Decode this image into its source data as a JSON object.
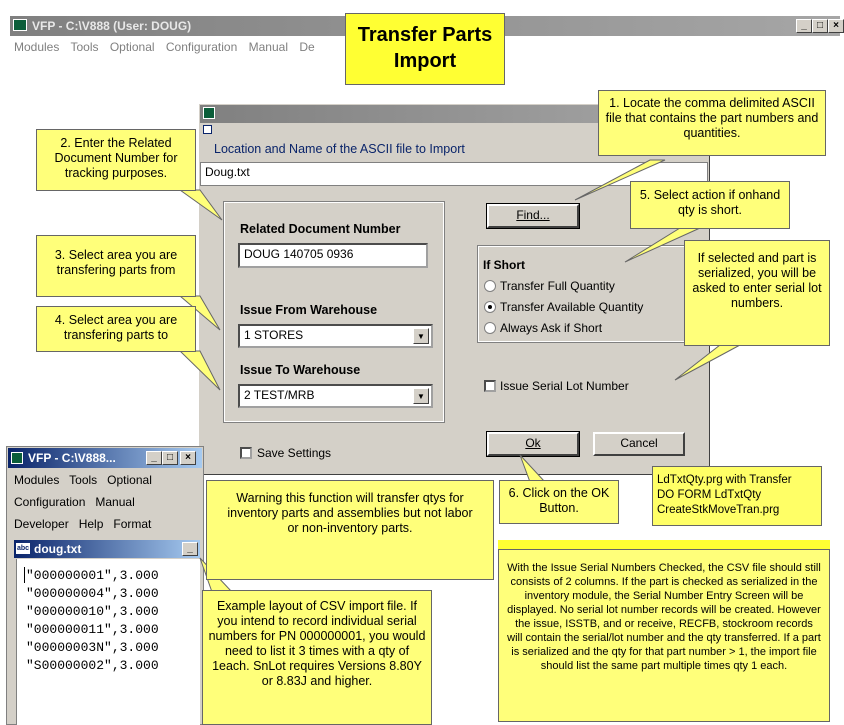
{
  "main_window": {
    "title": "VFP - C:\\V888 (User: DOUG)",
    "menu": [
      "Modules",
      "Tools",
      "Optional",
      "Configuration",
      "Manual",
      "De"
    ]
  },
  "banner": "Transfer Parts\nImport",
  "dialog": {
    "location_label": "Location and Name of the ASCII file to Import",
    "file_value": "Doug.txt",
    "related_doc_label": "Related Document Number",
    "related_doc_value": "DOUG 140705 0936",
    "from_label": "Issue From Warehouse",
    "from_value": "1  STORES",
    "to_label": "Issue To Warehouse",
    "to_value": "2  TEST/MRB",
    "find_button": "Find...",
    "if_short_label": "If Short",
    "options": [
      {
        "label": "Transfer Full Quantity",
        "selected": false
      },
      {
        "label": "Transfer Available Quantity",
        "selected": true
      },
      {
        "label": "Always Ask if Short",
        "selected": false
      }
    ],
    "serial_checkbox": "Issue Serial Lot Number",
    "save_settings": "Save Settings",
    "ok_button": "Ok",
    "cancel_button": "Cancel"
  },
  "mini_window": {
    "title": "VFP - C:\\V888...",
    "menu_lines": [
      "Modules   Tools   Optional",
      "Configuration   Manual",
      "Developer   Help   Format"
    ],
    "doc_title": "doug.txt",
    "lines": [
      "\"000000001\",3.000",
      "\"000000004\",3.000",
      "\"000000010\",3.000",
      "\"000000011\",3.000",
      "\"00000003N\",3.000",
      "\"S00000002\",3.000"
    ]
  },
  "callouts": {
    "c1": "1. Locate the comma delimited ASCII file that contains the part numbers and quantities.",
    "c2": "2. Enter the Related Document Number for tracking purposes.",
    "c3": "3. Select area you are transfering  parts from",
    "c4": "4. Select area you are transfering parts to",
    "c5": "5. Select action if onhand qty is short.",
    "c6": "6. Click on the OK Button.",
    "serialized": "If selected and part is serialized, you will be asked to enter serial lot numbers.",
    "warning": "Warning this function will transfer qtys for inventory parts and assemblies but not labor or non-inventory parts.",
    "example": "Example layout of CSV import file. If you intend to record individual serial numbers for PN 000000001, you would need to list it 3 times with a qty of 1each. SnLot requires Versions 8.80Y or 8.83J and higher.",
    "program": "LdTxtQty.prg with Transfer\nDO FORM LdTxtQty\nCreateStkMoveTran.prg",
    "serial_notes": "With the Issue Serial Numbers Checked, the CSV file should still consists of 2 columns.  If the part is checked as serialized in the inventory module, the Serial Number Entry Screen will be displayed.  No serial lot number records will be created.  However the issue, ISSTB, and or receive, RECFB, stockroom records will contain the serial/lot number and the qty transferred.  If a part is serialized and the qty for that part number > 1, the import file should list the same part multiple times qty 1 each."
  },
  "colors": {
    "callout": "#ffff7a",
    "dialog": "#d4d0c8",
    "title_active": "#0a246a"
  }
}
